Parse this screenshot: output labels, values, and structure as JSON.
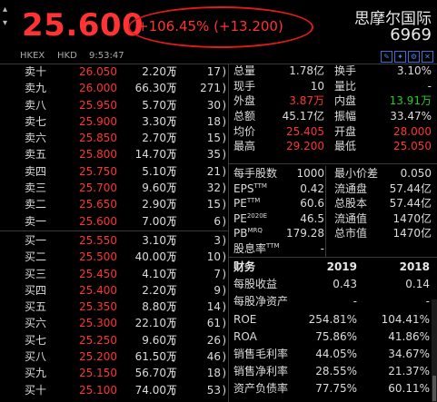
{
  "header": {
    "price": "25.600",
    "change": "+106.45% (+13.200)",
    "name": "思摩尔国际",
    "code": "6969",
    "side_arrow_up": "▴",
    "side_arrow_down": "▾"
  },
  "infobar": {
    "market": "HKEX",
    "currency": "HKD",
    "time": "9:53:47",
    "icons": [
      "edit-icon",
      "star-icon",
      "settings-icon",
      "close-icon"
    ],
    "icon_glyphs": [
      "✎",
      "✦",
      "⚙",
      "✕"
    ]
  },
  "asks": [
    {
      "label": "卖十",
      "price": "26.050",
      "volume": "2.20万",
      "count": "17"
    },
    {
      "label": "卖九",
      "price": "26.000",
      "volume": "66.30万",
      "count": "271"
    },
    {
      "label": "卖八",
      "price": "25.950",
      "volume": "5.70万",
      "count": "30"
    },
    {
      "label": "卖七",
      "price": "25.900",
      "volume": "3.30万",
      "count": "18"
    },
    {
      "label": "卖六",
      "price": "25.850",
      "volume": "2.70万",
      "count": "15"
    },
    {
      "label": "卖五",
      "price": "25.800",
      "volume": "14.70万",
      "count": "35"
    },
    {
      "label": "卖四",
      "price": "25.750",
      "volume": "5.10万",
      "count": "21"
    },
    {
      "label": "卖三",
      "price": "25.700",
      "volume": "9.60万",
      "count": "32"
    },
    {
      "label": "卖二",
      "price": "25.650",
      "volume": "2.90万",
      "count": "15"
    },
    {
      "label": "卖一",
      "price": "25.600",
      "volume": "7.00万",
      "count": "6"
    }
  ],
  "bids": [
    {
      "label": "买一",
      "price": "25.550",
      "volume": "3.10万",
      "count": "3"
    },
    {
      "label": "买二",
      "price": "25.500",
      "volume": "40.00万",
      "count": "10"
    },
    {
      "label": "买三",
      "price": "25.450",
      "volume": "4.10万",
      "count": "7"
    },
    {
      "label": "买四",
      "price": "25.400",
      "volume": "2.20万",
      "count": "9"
    },
    {
      "label": "买五",
      "price": "25.350",
      "volume": "8.80万",
      "count": "14"
    },
    {
      "label": "买六",
      "price": "25.300",
      "volume": "22.10万",
      "count": "61"
    },
    {
      "label": "买七",
      "price": "25.250",
      "volume": "9.60万",
      "count": "26"
    },
    {
      "label": "买八",
      "price": "25.200",
      "volume": "61.50万",
      "count": "46"
    },
    {
      "label": "买九",
      "price": "25.150",
      "volume": "56.70万",
      "count": "18"
    },
    {
      "label": "买十",
      "price": "25.100",
      "volume": "74.00万",
      "count": "53"
    }
  ],
  "stats": [
    {
      "l1": "总量",
      "v1": "1.78亿",
      "l2": "换手",
      "v2": "3.10%",
      "c1": "",
      "c2": ""
    },
    {
      "l1": "现手",
      "v1": "10",
      "l2": "量比",
      "v2": "-",
      "c1": "",
      "c2": ""
    },
    {
      "l1": "外盘",
      "v1": "3.87万",
      "l2": "内盘",
      "v2": "13.91万",
      "c1": "red",
      "c2": "green"
    },
    {
      "l1": "总额",
      "v1": "45.17亿",
      "l2": "振幅",
      "v2": "33.47%",
      "c1": "",
      "c2": ""
    },
    {
      "l1": "均价",
      "v1": "25.405",
      "l2": "开盘",
      "v2": "28.000",
      "c1": "red",
      "c2": "red"
    },
    {
      "l1": "最高",
      "v1": "29.200",
      "l2": "最低",
      "v2": "25.050",
      "c1": "red",
      "c2": "red"
    }
  ],
  "pershare": [
    {
      "l1": "每手股数",
      "v1": "1000",
      "l2": "最小价差",
      "v2": "0.050",
      "sup": ""
    },
    {
      "l1": "EPS",
      "sup": "TTM",
      "v1": "0.42",
      "l2": "流通盘",
      "v2": "57.44亿"
    },
    {
      "l1": "PE",
      "sup": "TTM",
      "v1": "60.6",
      "l2": "总股本",
      "v2": "57.44亿"
    },
    {
      "l1": "PE",
      "sup": "2020E",
      "v1": "46.5",
      "l2": "流通值",
      "v2": "1470亿"
    },
    {
      "l1": "PB",
      "sup": "MRQ",
      "v1": "179.28",
      "l2": "总市值",
      "v2": "1470亿"
    },
    {
      "l1": "股息率",
      "sup": "TTM",
      "v1": "-",
      "l2": "",
      "v2": ""
    }
  ],
  "financials": {
    "header": {
      "label": "财务",
      "a": "2019",
      "b": "2018"
    },
    "rows": [
      {
        "label": "每股收益",
        "a": "0.43",
        "b": "0.14"
      },
      {
        "label": "每股净资产",
        "a": "-",
        "b": "-"
      },
      {
        "label": "ROE",
        "a": "254.81%",
        "b": "104.41%"
      },
      {
        "label": "ROA",
        "a": "75.86%",
        "b": "41.86%"
      },
      {
        "label": "销售毛利率",
        "a": "44.05%",
        "b": "34.67%"
      },
      {
        "label": "销售净利率",
        "a": "28.55%",
        "b": "21.37%"
      },
      {
        "label": "资产负债率",
        "a": "77.75%",
        "b": "60.11%"
      }
    ]
  },
  "colors": {
    "up": "#ff3333",
    "down": "#22cc22",
    "highlight_ellipse": "#e01b1b",
    "background": "#000000"
  }
}
